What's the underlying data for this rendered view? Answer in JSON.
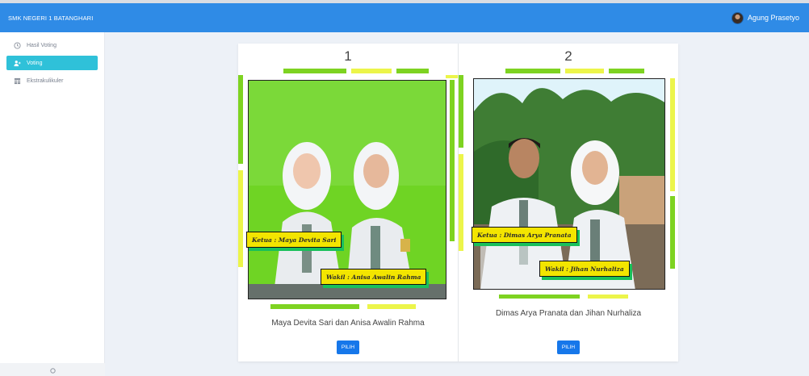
{
  "header": {
    "brand": "SMK NEGERI 1 BATANGHARI",
    "user_name": "Agung Prasetyo"
  },
  "sidebar": {
    "items": [
      {
        "label": "Hasil Voting",
        "icon": "clock-icon",
        "active": false
      },
      {
        "label": "Voting",
        "icon": "user-plus-icon",
        "active": true
      },
      {
        "label": "Ekstrakulikuler",
        "icon": "table-icon",
        "active": false
      }
    ]
  },
  "candidates": [
    {
      "number": "1",
      "ketua_caption": "Ketua : Maya Devita Sari",
      "wakil_caption": "Wakil : Anisa Awalin Rahma",
      "name": "Maya Devita Sari dan Anisa Awalin Rahma",
      "button": "PILIH"
    },
    {
      "number": "2",
      "ketua_caption": "Ketua : Dimas Arya Pranata",
      "wakil_caption": "Wakil : Jihan Nurhaliza",
      "name": "Dimas Arya Pranata dan Jihan Nurhaliza",
      "button": "PILIH"
    }
  ],
  "colors": {
    "topbar": "#2f8be6",
    "active_nav": "#2fc1d9",
    "button": "#1677ea",
    "frame_green": "#7ed321",
    "caption_yellow": "#f3e500"
  }
}
